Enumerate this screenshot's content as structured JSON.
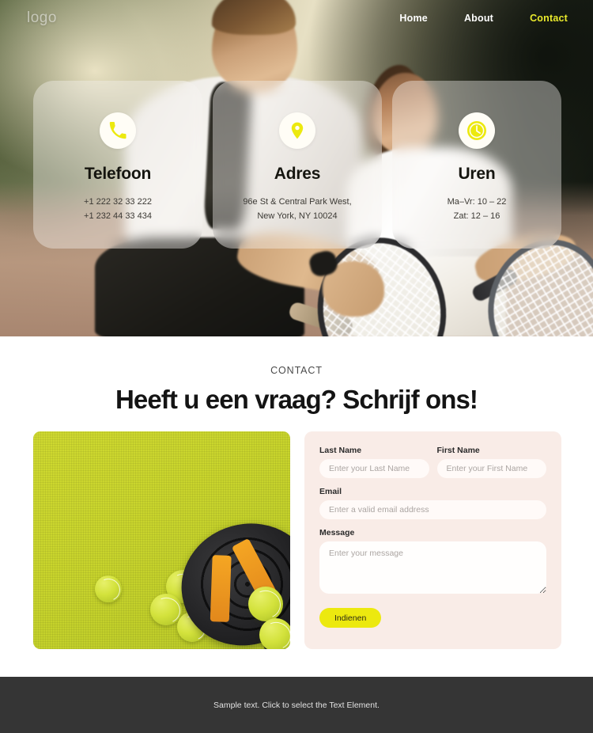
{
  "nav": {
    "logo": "logo",
    "links": [
      {
        "label": "Home",
        "active": false
      },
      {
        "label": "About",
        "active": false
      },
      {
        "label": "Contact",
        "active": true
      }
    ],
    "active_color": "#e9e92c"
  },
  "hero": {
    "cards": [
      {
        "icon": "phone-icon",
        "title": "Telefoon",
        "lines": [
          "+1 222 32 33 222",
          "+1 232 44 33 434"
        ]
      },
      {
        "icon": "map-pin-icon",
        "title": "Adres",
        "lines": [
          "96e St & Central Park West,",
          "New York, NY 10024"
        ]
      },
      {
        "icon": "clock-icon",
        "title": "Uren",
        "lines": [
          "Ma–Vr: 10 – 22",
          "Zat: 12 – 16"
        ]
      }
    ],
    "icon_color": "#ece90f"
  },
  "contact": {
    "eyebrow": "CONTACT",
    "title": "Heeft u een vraag? Schrijf ons!",
    "panel_color": "#f9ece7",
    "form": {
      "last_name": {
        "label": "Last Name",
        "placeholder": "Enter your Last Name",
        "value": ""
      },
      "first_name": {
        "label": "First Name",
        "placeholder": "Enter your First Name",
        "value": ""
      },
      "email": {
        "label": "Email",
        "placeholder": "Enter a valid email address",
        "value": ""
      },
      "message": {
        "label": "Message",
        "placeholder": "Enter your message",
        "value": ""
      },
      "submit_label": "Indienen",
      "submit_color": "#ece90f"
    }
  },
  "footer": {
    "text": "Sample text. Click to select the Text Element.",
    "background": "#353535"
  }
}
